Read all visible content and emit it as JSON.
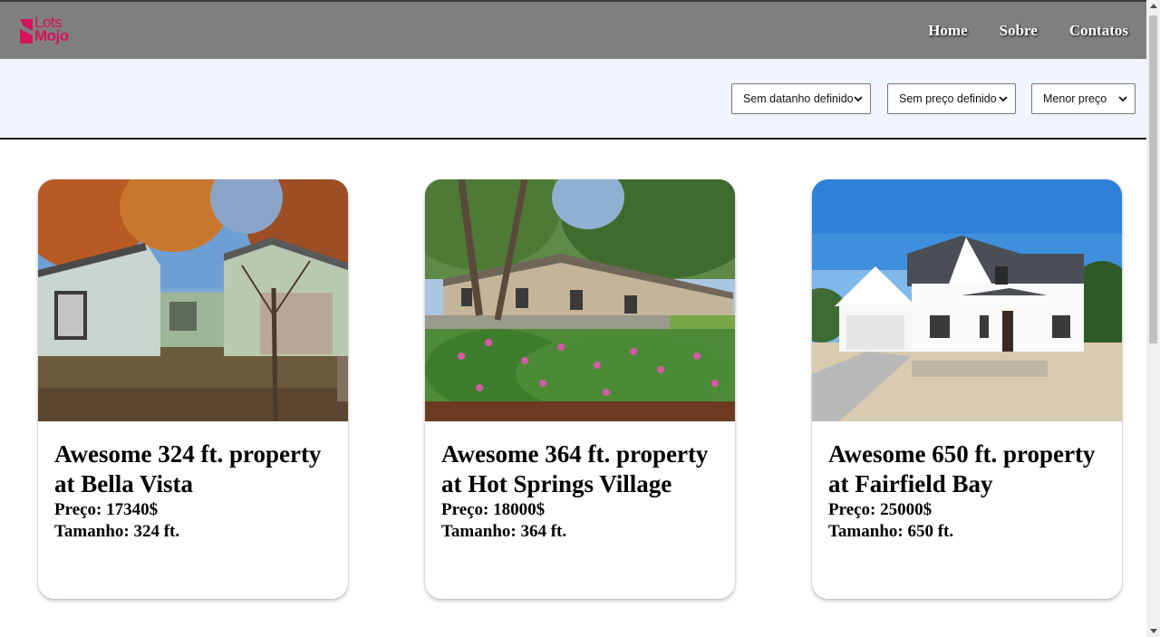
{
  "brand": {
    "line1": "Lots",
    "line2": "Mojo",
    "color": "#d4145a"
  },
  "nav": {
    "items": [
      "Home",
      "Sobre",
      "Contatos"
    ]
  },
  "filters": {
    "size_selected": "Sem datanho definido",
    "price_selected": "Sem preço definido",
    "order_selected": "Menor preço"
  },
  "listings": [
    {
      "title": "Awesome 324 ft. property at Bella Vista",
      "price": "Preço: 17340$",
      "size": "Tamanho: 324 ft.",
      "image": "autumn-house-photo"
    },
    {
      "title": "Awesome 364 ft. property at Hot Springs Village",
      "price": "Preço: 18000$",
      "size": "Tamanho: 364 ft.",
      "image": "townhouses-garden-photo"
    },
    {
      "title": "Awesome 650 ft. property at Fairfield Bay",
      "price": "Preço: 25000$",
      "size": "Tamanho: 650 ft.",
      "image": "white-farmhouse-photo"
    }
  ],
  "colors": {
    "navbar": "#7f7f7f",
    "filterbar": "#f0f5ff"
  }
}
